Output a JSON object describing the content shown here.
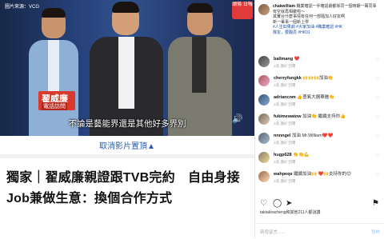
{
  "video": {
    "credit": "圖片來源：VCG",
    "logo_text": "頭條 日報",
    "name_tag_name": "翟威廉",
    "name_tag_sub": "電話訪問",
    "subtitle": "不論是藝能界還是其他好多界別",
    "volume_icon": "speaker-icon"
  },
  "article": {
    "collapse_label": "取消影片置頂▲",
    "headline": "獨家｜翟威廉親證跟TVB完約　自由身接Job兼做生意：換個合作方式"
  },
  "post": {
    "username": "chakwilliam",
    "caption": "職業確認一手確認劇都係同一個時期一萬同事有空就再相聚啦～",
    "caption2": "其實台什麼事情有任何一部隨加人好友啊",
    "caption3": "新一輩事一個新上學",
    "tags": "#人生如果劇 #大家加油 #職業確認 #HK",
    "meta": "隊友，要翻頁 #HK01",
    "comments": [
      {
        "user": "ballmang",
        "text": "❤️",
        "meta": "2週 讚好 回覆"
      },
      {
        "user": "cherryfungkk",
        "text": "🙌🙌🙌加油👏",
        "meta": "2週 讚好 回覆"
      },
      {
        "user": "adriancnm",
        "text": "👍勇氣大器華麗👏",
        "meta": "2週 讚好 回覆"
      },
      {
        "user": "fukimewatow",
        "text": "加油👏 繼續支持你👍",
        "meta": "2週 讚好 回覆"
      },
      {
        "user": "nnnngel",
        "text": "加油 Mr.William❤️❤️",
        "meta": "2週 讚好 回覆"
      },
      {
        "user": "hugp628",
        "text": "👏👏💪",
        "meta": "2週 讚好 回覆"
      },
      {
        "user": "wahpeqe",
        "text": "繼續加油🙌 ❤️🙌支持你的😊",
        "meta": "2週 讚好 回覆"
      }
    ],
    "likes": "taktakiracheng和其他211人都說讚",
    "add_comment_placeholder": "新增留言......",
    "post_label": "發佈"
  }
}
